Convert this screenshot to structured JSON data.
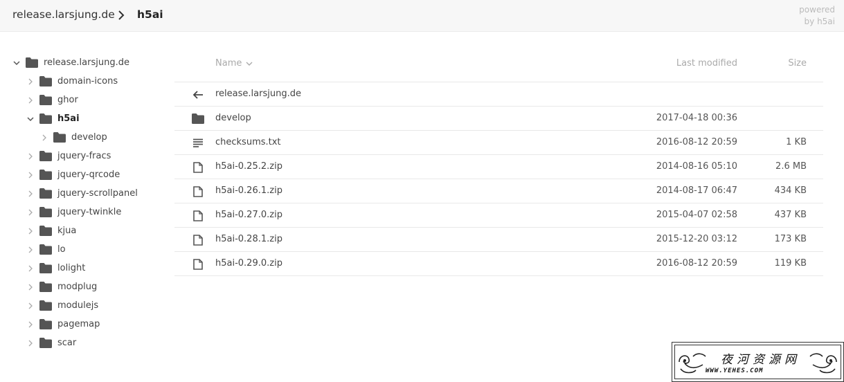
{
  "breadcrumb": {
    "items": [
      "release.larsjung.de",
      "h5ai"
    ]
  },
  "powered": {
    "line1": "powered",
    "line2": "by h5ai"
  },
  "tree": {
    "items": [
      {
        "label": "release.larsjung.de",
        "level": 0,
        "expanded": true
      },
      {
        "label": "domain-icons",
        "level": 1,
        "expanded": false
      },
      {
        "label": "ghor",
        "level": 1,
        "expanded": false
      },
      {
        "label": "h5ai",
        "level": 1,
        "expanded": true,
        "active": true
      },
      {
        "label": "develop",
        "level": 2,
        "expanded": false
      },
      {
        "label": "jquery-fracs",
        "level": 1,
        "expanded": false
      },
      {
        "label": "jquery-qrcode",
        "level": 1,
        "expanded": false
      },
      {
        "label": "jquery-scrollpanel",
        "level": 1,
        "expanded": false
      },
      {
        "label": "jquery-twinkle",
        "level": 1,
        "expanded": false
      },
      {
        "label": "kjua",
        "level": 1,
        "expanded": false
      },
      {
        "label": "lo",
        "level": 1,
        "expanded": false
      },
      {
        "label": "lolight",
        "level": 1,
        "expanded": false
      },
      {
        "label": "modplug",
        "level": 1,
        "expanded": false
      },
      {
        "label": "modulejs",
        "level": 1,
        "expanded": false
      },
      {
        "label": "pagemap",
        "level": 1,
        "expanded": false
      },
      {
        "label": "scar",
        "level": 1,
        "expanded": false
      }
    ]
  },
  "listing": {
    "columns": {
      "name": "Name",
      "modified": "Last modified",
      "size": "Size"
    },
    "rows": [
      {
        "icon": "back-arrow-icon",
        "name": "release.larsjung.de",
        "modified": "",
        "size": ""
      },
      {
        "icon": "folder-icon",
        "name": "develop",
        "modified": "2017-04-18 00:36",
        "size": ""
      },
      {
        "icon": "text-file-icon",
        "name": "checksums.txt",
        "modified": "2016-08-12 20:59",
        "size": "1 KB"
      },
      {
        "icon": "archive-file-icon",
        "name": "h5ai-0.25.2.zip",
        "modified": "2014-08-16 05:10",
        "size": "2.6 MB"
      },
      {
        "icon": "archive-file-icon",
        "name": "h5ai-0.26.1.zip",
        "modified": "2014-08-17 06:47",
        "size": "434 KB"
      },
      {
        "icon": "archive-file-icon",
        "name": "h5ai-0.27.0.zip",
        "modified": "2015-04-07 02:58",
        "size": "437 KB"
      },
      {
        "icon": "archive-file-icon",
        "name": "h5ai-0.28.1.zip",
        "modified": "2015-12-20 03:12",
        "size": "173 KB"
      },
      {
        "icon": "archive-file-icon",
        "name": "h5ai-0.29.0.zip",
        "modified": "2016-08-12 20:59",
        "size": "119 KB"
      }
    ]
  },
  "watermark": {
    "title": "夜河资源网",
    "url": "WWW.YEHES.COM"
  },
  "colors": {
    "topbar_bg": "#f7f7f7",
    "folder": "#555555",
    "text": "#444444",
    "muted": "#aaaaaa"
  }
}
